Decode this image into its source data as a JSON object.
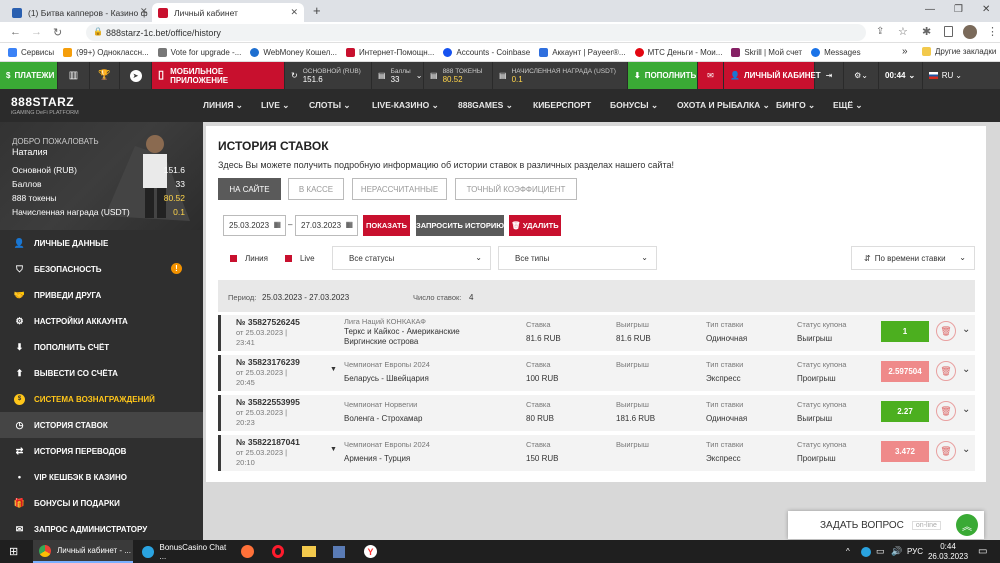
{
  "browser": {
    "tabs": [
      {
        "title": "(1) Битва капперов - Казино фо"
      },
      {
        "title": "Личный кабинет"
      }
    ],
    "url": "888starz-1c.bet/office/history",
    "bookmarks": [
      "Сервисы",
      "(99+) Одноклассн...",
      "Vote for upgrade -...",
      "WebMoney Кошел...",
      "Интернет-Помощн...",
      "Accounts - Coinbase",
      "Аккаунт | Payeer®...",
      "МТС Деньги - Мои...",
      "Skrill | Мой счет",
      "Messages"
    ],
    "bookmarks_more": "»",
    "other_bookmarks": "Другие закладки"
  },
  "topbar": {
    "payments": "ПЛАТЕЖИ",
    "mobile_line1": "МОБИЛЬНОЕ",
    "mobile_line2": "ПРИЛОЖЕНИЕ",
    "main_label": "ОСНОВНОЙ (RUB)",
    "main_value": "151.6",
    "points_label": "Баллы",
    "points_value": "33",
    "tokens_label": "888 ТОКЕНЫ",
    "tokens_value": "80.52",
    "reward_label": "НАЧИСЛЕННАЯ НАГРАДА (USDT)",
    "reward_value": "0.1",
    "deposit": "ПОПОЛНИТЬ",
    "cabinet": "ЛИЧНЫЙ КАБИНЕТ",
    "time": "00:44",
    "lang": "RU"
  },
  "logo": {
    "brand": "888STARZ",
    "tagline": "iGAMING DeFi PLATFORM"
  },
  "mainnav": [
    "ЛИНИЯ",
    "LIVE",
    "СЛОТЫ",
    "LIVE-КАЗИНО",
    "888GAMES",
    "КИБЕРСПОРТ",
    "БОНУСЫ",
    "ОХОТА И РЫБАЛКА",
    "БИНГО",
    "ЕЩЁ"
  ],
  "profile": {
    "welcome": "ДОБРО ПОЖАЛОВАТЬ",
    "name": "Наталия",
    "rows": [
      {
        "label": "Основной (RUB)",
        "value": "151.6"
      },
      {
        "label": "Баллов",
        "value": "33"
      },
      {
        "label": "888 токены",
        "value": "80.52"
      },
      {
        "label": "Начисленная награда (USDT)",
        "value": "0.1"
      }
    ]
  },
  "sidebar": [
    {
      "label": "ЛИЧНЫЕ ДАННЫЕ",
      "icon": "user-icon"
    },
    {
      "label": "БЕЗОПАСНОСТЬ",
      "icon": "shield-icon"
    },
    {
      "label": "ПРИВЕДИ ДРУГА",
      "icon": "handshake-icon"
    },
    {
      "label": "НАСТРОЙКИ АККАУНТА",
      "icon": "gear-icon"
    },
    {
      "label": "ПОПОЛНИТЬ СЧЁТ",
      "icon": "download-icon"
    },
    {
      "label": "ВЫВЕСТИ СО СЧЁТА",
      "icon": "upload-icon"
    },
    {
      "label": "СИСТЕМА ВОЗНАГРАЖДЕНИЙ",
      "icon": "reward-icon"
    },
    {
      "label": "ИСТОРИЯ СТАВОК",
      "icon": "clock-icon"
    },
    {
      "label": "ИСТОРИЯ ПЕРЕВОДОВ",
      "icon": "transfer-icon"
    },
    {
      "label": "VIP КЕШБЭК В КАЗИНО",
      "icon": "dot-icon"
    },
    {
      "label": "БОНУСЫ И ПОДАРКИ",
      "icon": "gift-icon"
    },
    {
      "label": "ЗАПРОС АДМИНИСТРАТОРУ",
      "icon": "mail-icon"
    }
  ],
  "history": {
    "title": "ИСТОРИЯ СТАВОК",
    "subtitle": "Здесь Вы можете получить подробную информацию об истории ставок в различных разделах нашего сайта!",
    "tabs": [
      "НА САЙТЕ",
      "В КАССЕ",
      "НЕРАССЧИТАННЫЕ",
      "ТОЧНЫЙ КОЭФФИЦИЕНТ"
    ],
    "date_from": "25.03.2023",
    "date_to": "27.03.2023",
    "dash": "–",
    "show": "ПОКАЗАТЬ",
    "request": "ЗАПРОСИТЬ ИСТОРИЮ",
    "delete": "УДАЛИТЬ",
    "filter_line": "Линия",
    "filter_live": "Live",
    "status_select": "Все статусы",
    "type_select": "Все типы",
    "sort": "По времени ставки",
    "period_label": "Период:",
    "period_value": "25.03.2023 - 27.03.2023",
    "count_label": "Число ставок:",
    "count_value": "4",
    "col_stake": "Ставка",
    "col_win": "Выигрыш",
    "col_type": "Тип ставки",
    "col_status": "Статус купона",
    "bets": [
      {
        "id": "№ 35827526245",
        "date": "от 25.03.2023 |",
        "time": "23:41",
        "league": "Лига Наций КОНКАКАФ",
        "event1": "Теркс и Кайкос - Американские",
        "event2": "Виргинские острова",
        "stake": "81.6 RUB",
        "win": "81.6 RUB",
        "type": "Одиночная",
        "status": "Выигрыш",
        "coef": "1",
        "color": "#4caf1f",
        "expandable": false
      },
      {
        "id": "№ 35823176239",
        "date": "от 25.03.2023 |",
        "time": "20:45",
        "league": "Чемпионат Европы 2024",
        "event1": "Беларусь - Швейцария",
        "event2": "",
        "stake": "100 RUB",
        "win": "",
        "type": "Экспресс",
        "status": "Проигрыш",
        "coef": "2.597504",
        "color": "#ef8a8a",
        "expandable": true
      },
      {
        "id": "№ 35822553995",
        "date": "от 25.03.2023 |",
        "time": "20:23",
        "league": "Чемпионат Норвегии",
        "event1": "Воленга - Строхамар",
        "event2": "",
        "stake": "80 RUB",
        "win": "181.6 RUB",
        "type": "Одиночная",
        "status": "Выигрыш",
        "coef": "2.27",
        "color": "#4caf1f",
        "expandable": false
      },
      {
        "id": "№ 35822187041",
        "date": "от 25.03.2023 |",
        "time": "20:10",
        "league": "Чемпионат Европы 2024",
        "event1": "Армения - Турция",
        "event2": "",
        "stake": "150 RUB",
        "win": "",
        "type": "Экспресс",
        "status": "Проигрыш",
        "coef": "3.472",
        "color": "#ef8a8a",
        "expandable": true
      }
    ]
  },
  "chat": {
    "label": "ЗАДАТЬ ВОПРОС",
    "status": "on-line"
  },
  "taskbar": {
    "chrome": "Личный кабинет - ...",
    "telegram": "BonusCasino Chat ...",
    "lang": "РУС",
    "time": "0:44",
    "date": "26.03.2023"
  },
  "colors": {
    "accent_red": "#c8102e",
    "green": "#3aaa35",
    "gold": "#ffc61a"
  }
}
